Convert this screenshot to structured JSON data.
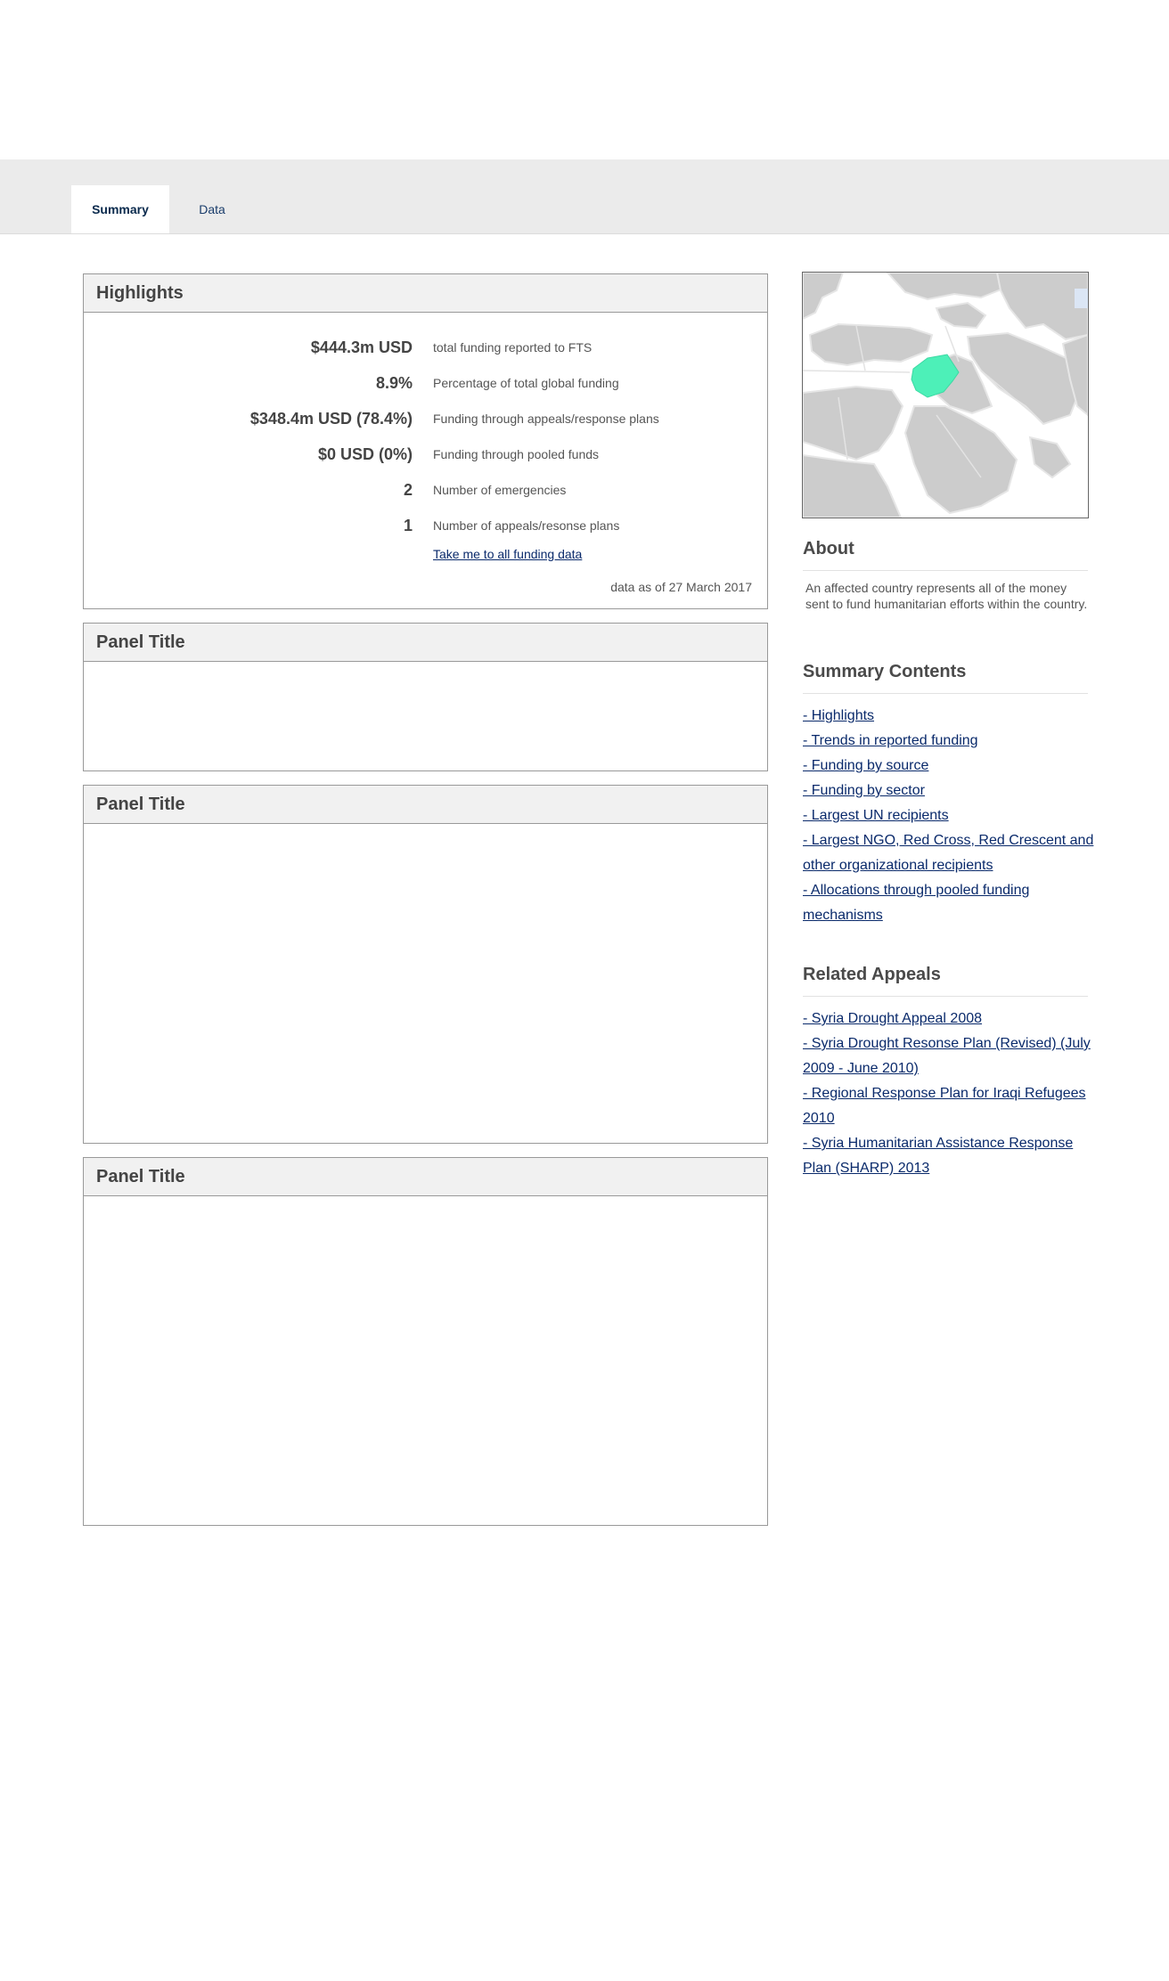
{
  "tabs": {
    "summary": "Summary",
    "data": "Data"
  },
  "highlights": {
    "title": "Highlights",
    "rows": [
      {
        "value": "$444.3m USD",
        "label": "total funding reported to FTS"
      },
      {
        "value": "8.9%",
        "label": "Percentage of total global funding"
      },
      {
        "value": "$348.4m USD (78.4%)",
        "label": "Funding through appeals/response plans"
      },
      {
        "value": "$0 USD (0%)",
        "label": "Funding through pooled funds"
      },
      {
        "value": "2",
        "label": "Number of emergencies"
      },
      {
        "value": "1",
        "label": "Number of appeals/resonse plans"
      }
    ],
    "link": "Take me to all funding data",
    "as_of": "data as of 27 March 2017"
  },
  "panels": [
    {
      "title": "Panel Title"
    },
    {
      "title": "Panel Title"
    },
    {
      "title": "Panel Title"
    }
  ],
  "map": {
    "highlight_color": "#4df0b8",
    "land_color": "#cccccc"
  },
  "about": {
    "heading": "About",
    "text": "An affected country represents all of the money sent to fund humanitarian efforts within the country."
  },
  "summary_contents": {
    "heading": "Summary Contents",
    "items": [
      "- Highlights",
      "- Trends in reported funding",
      "- Funding by source",
      "- Funding by sector",
      "- Largest UN recipients",
      "- Largest NGO, Red Cross, Red Crescent and other organizational recipients",
      "- Allocations through pooled funding mechanisms"
    ]
  },
  "related_appeals": {
    "heading": "Related Appeals",
    "items": [
      "- Syria Drought Appeal 2008",
      "- Syria Drought Resonse Plan (Revised) (July 2009 - June 2010)",
      "- Regional Response Plan for Iraqi Refugees 2010",
      "- Syria Humanitarian Assistance Response Plan (SHARP) 2013"
    ]
  }
}
